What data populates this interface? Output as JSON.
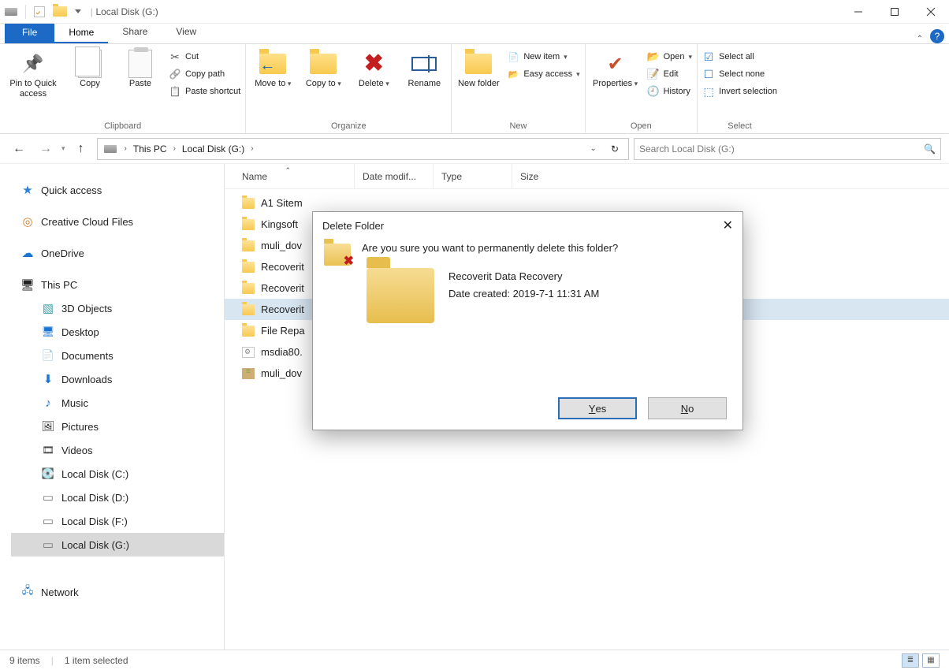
{
  "title": "Local Disk (G:)",
  "tabs": {
    "file": "File",
    "home": "Home",
    "share": "Share",
    "view": "View"
  },
  "ribbon": {
    "pin": "Pin to Quick access",
    "copy": "Copy",
    "paste": "Paste",
    "cut": "Cut",
    "copypath": "Copy path",
    "pastesc": "Paste shortcut",
    "clipboard": "Clipboard",
    "moveto": "Move to",
    "copyto": "Copy to",
    "delete": "Delete",
    "rename": "Rename",
    "organize": "Organize",
    "newfolder": "New folder",
    "newitem": "New item",
    "easyaccess": "Easy access",
    "new": "New",
    "properties": "Properties",
    "open": "Open",
    "edit": "Edit",
    "history": "History",
    "open_group": "Open",
    "selall": "Select all",
    "selnone": "Select none",
    "invsel": "Invert selection",
    "select": "Select"
  },
  "breadcrumb": {
    "root": "This PC",
    "leaf": "Local Disk (G:)"
  },
  "search_placeholder": "Search Local Disk (G:)",
  "cols": {
    "name": "Name",
    "date": "Date modif...",
    "type": "Type",
    "size": "Size"
  },
  "tree": {
    "quick": "Quick access",
    "cc": "Creative Cloud Files",
    "od": "OneDrive",
    "pc": "This PC",
    "obj": "3D Objects",
    "desk": "Desktop",
    "doc": "Documents",
    "down": "Downloads",
    "music": "Music",
    "pic": "Pictures",
    "vid": "Videos",
    "dc": "Local Disk (C:)",
    "dd": "Local Disk (D:)",
    "df": "Local Disk (F:)",
    "dg": "Local Disk (G:)",
    "net": "Network"
  },
  "files": {
    "f0": "A1 Sitem",
    "f1": "Kingsoft",
    "f2": "muli_dov",
    "f3": "Recoverit",
    "f4": "Recoverit",
    "f5": "Recoverit",
    "f6": "File Repa",
    "f7": "msdia80.",
    "f8": "muli_dov"
  },
  "status": {
    "count": "9 items",
    "sel": "1 item selected"
  },
  "dialog": {
    "title": "Delete Folder",
    "question": "Are you sure you want to permanently delete this folder?",
    "name": "Recoverit Data Recovery",
    "created": "Date created: 2019-7-1 11:31 AM",
    "yes": "Yes",
    "no": "No"
  }
}
